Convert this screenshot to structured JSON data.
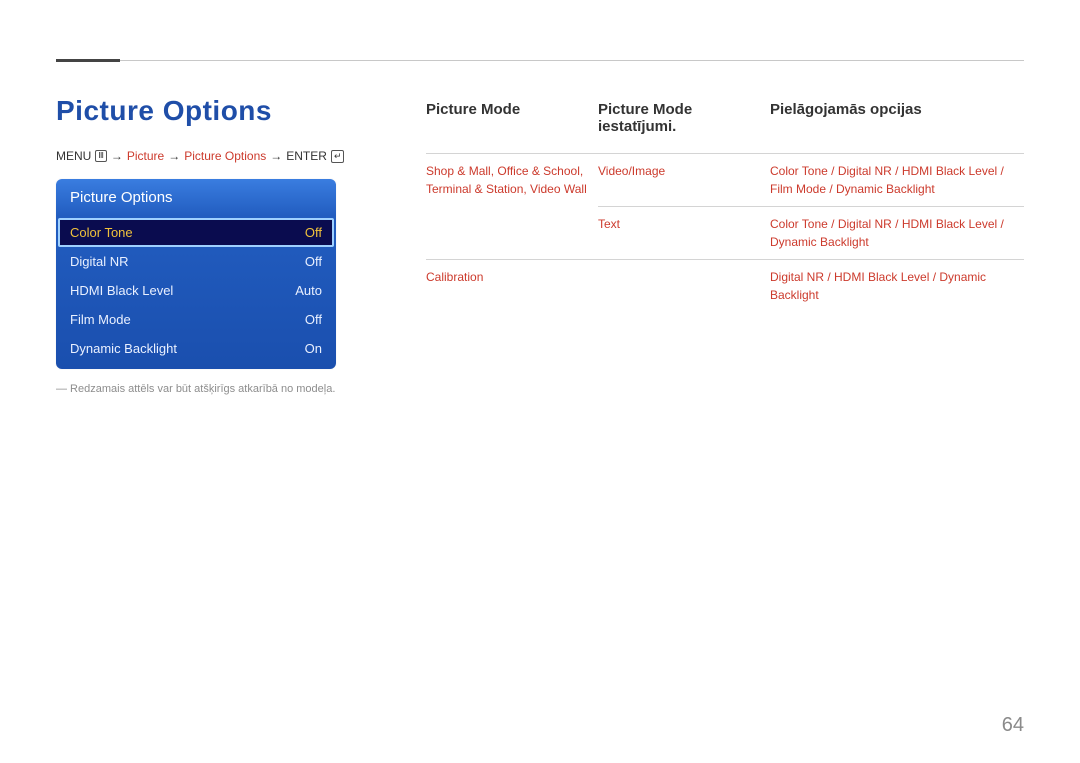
{
  "title": "Picture Options",
  "breadcrumb": {
    "menu": "MENU",
    "arrow": "→",
    "picture": "Picture",
    "picture_options": "Picture Options",
    "enter": "ENTER"
  },
  "menu": {
    "header": "Picture Options",
    "rows": [
      {
        "label": "Color Tone",
        "value": "Off",
        "selected": true
      },
      {
        "label": "Digital NR",
        "value": "Off",
        "selected": false
      },
      {
        "label": "HDMI Black Level",
        "value": "Auto",
        "selected": false
      },
      {
        "label": "Film Mode",
        "value": "Off",
        "selected": false
      },
      {
        "label": "Dynamic Backlight",
        "value": "On",
        "selected": false
      }
    ]
  },
  "footnote": "― Redzamais attēls var būt atšķirīgs atkarībā no modeļa.",
  "right": {
    "headers": {
      "col1": "Picture Mode",
      "col2": "Picture Mode iestatījumi.",
      "col3": "Pielāgojamās opcijas"
    },
    "rows": [
      {
        "mode": "Shop & Mall, Office & School, Terminal & Station, Video Wall",
        "setting": "Video/Image",
        "options": "Color Tone / Digital NR / HDMI Black Level / Film Mode / Dynamic Backlight"
      },
      {
        "mode": "",
        "setting": "Text",
        "options": "Color Tone / Digital NR / HDMI Black Level / Dynamic Backlight"
      },
      {
        "mode": "Calibration",
        "setting": "",
        "options": "Digital NR / HDMI Black Level / Dynamic Backlight"
      }
    ]
  },
  "page_number": "64"
}
